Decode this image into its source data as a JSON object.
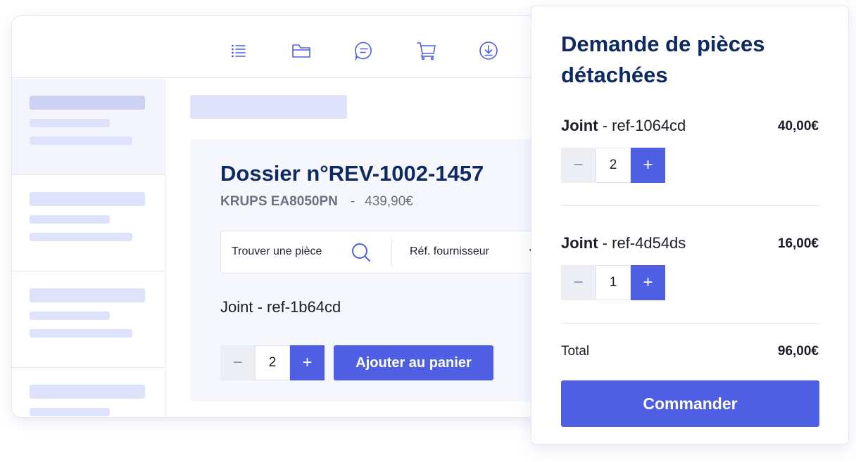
{
  "toolbar": {
    "icons": [
      "list-icon",
      "folder-icon",
      "chat-icon",
      "cart-icon",
      "download-icon"
    ]
  },
  "dossier": {
    "title": "Dossier n°REV-1002-1457",
    "model": "KRUPS EA8050PN",
    "separator": "-",
    "price": "439,90€"
  },
  "search": {
    "placeholder": "Trouver une pièce",
    "supplier_ref_label": "Réf. fournisseur"
  },
  "part": {
    "label": "Joint - ref-1b64cd",
    "quantity": "2",
    "add_button": "Ajouter au panier"
  },
  "panel": {
    "title": "Demande de pièces détachées",
    "items": [
      {
        "name": "Joint",
        "ref": " - ref-1064cd",
        "quantity": "2",
        "price": "40,00€"
      },
      {
        "name": "Joint",
        "ref": " - ref-4d54ds",
        "quantity": "1",
        "price": "16,00€"
      }
    ],
    "total_label": "Total",
    "total_value": "96,00€",
    "order_button": "Commander"
  },
  "stepper": {
    "minus": "−",
    "plus": "+"
  },
  "colors": {
    "accent": "#4f5fe3",
    "heading": "#0f2a63",
    "skeleton": "#dfe2fb"
  }
}
